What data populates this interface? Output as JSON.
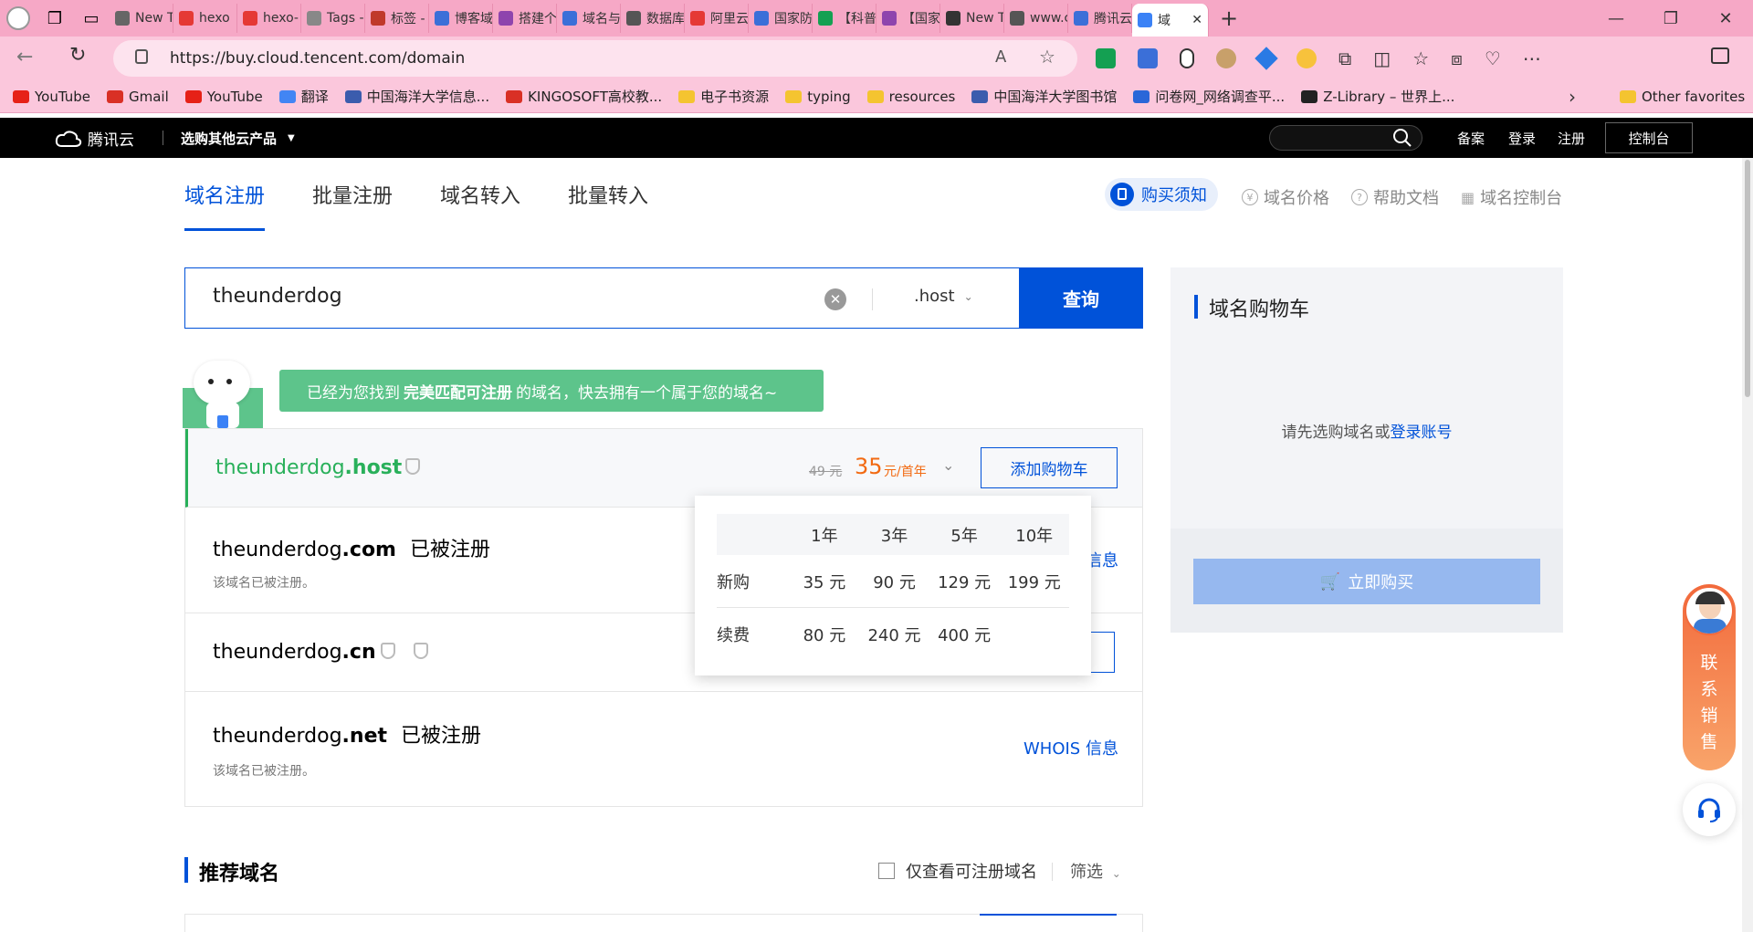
{
  "browser": {
    "tabs": [
      {
        "label": "New T"
      },
      {
        "label": "hexo"
      },
      {
        "label": "hexo-"
      },
      {
        "label": "Tags -"
      },
      {
        "label": "标签 -"
      },
      {
        "label": "博客域"
      },
      {
        "label": "搭建个"
      },
      {
        "label": "域名与"
      },
      {
        "label": "数据库"
      },
      {
        "label": "阿里云"
      },
      {
        "label": "国家防"
      },
      {
        "label": "【科普"
      },
      {
        "label": "【国家"
      },
      {
        "label": "New T"
      },
      {
        "label": "www.c"
      },
      {
        "label": "腾讯云"
      },
      {
        "label": "域"
      }
    ],
    "url": "https://buy.cloud.tencent.com/domain",
    "bookmarks": [
      {
        "label": "YouTube",
        "color": "#e62117"
      },
      {
        "label": "Gmail",
        "color": "#d93025"
      },
      {
        "label": "YouTube",
        "color": "#e62117"
      },
      {
        "label": "翻译",
        "color": "#4285f4"
      },
      {
        "label": "中国海洋大学信息...",
        "color": "#3b5cad"
      },
      {
        "label": "KINGOSOFT高校教...",
        "color": "#d93025"
      },
      {
        "label": "电子书资源",
        "color": "#f4c430"
      },
      {
        "label": "typing",
        "color": "#f4c430"
      },
      {
        "label": "resources",
        "color": "#f4c430"
      },
      {
        "label": "中国海洋大学图书馆",
        "color": "#3b5cad"
      },
      {
        "label": "问卷网_网络调查平...",
        "color": "#2a66d8"
      },
      {
        "label": "Z-Library – 世界上...",
        "color": "#222"
      }
    ],
    "other_favorites": "Other favorites"
  },
  "tc_header": {
    "logo": "腾讯云",
    "menu": "选购其他云产品",
    "links": [
      "备案",
      "登录",
      "注册"
    ],
    "console": "控制台"
  },
  "subnav": {
    "tabs": [
      "域名注册",
      "批量注册",
      "域名转入",
      "批量转入"
    ],
    "notice": "购买须知",
    "links": [
      "域名价格",
      "帮助文档",
      "域名控制台"
    ]
  },
  "search": {
    "query": "theunderdog",
    "suffix": ".host",
    "button": "查询"
  },
  "banner": {
    "prefix": "已经为您找到",
    "highlight": "完美匹配可注册",
    "suffix": "的域名，快去拥有一个属于您的域名~"
  },
  "results": [
    {
      "base": "theunderdog",
      "tld": ".host",
      "old_price": "49 元",
      "price": "35",
      "unit": "元/首年",
      "action": "添加购物车"
    },
    {
      "base": "theunderdog",
      "tld": ".com",
      "status": "已被注册",
      "note": "该域名已被注册。",
      "action": "WHOIS 信息"
    },
    {
      "base": "theunderdog",
      "tld": ".cn"
    },
    {
      "base": "theunderdog",
      "tld": ".net",
      "status": "已被注册",
      "note": "该域名已被注册。",
      "action": "WHOIS 信息"
    }
  ],
  "price_popover": {
    "headers": [
      "1年",
      "3年",
      "5年",
      "10年"
    ],
    "rows": [
      {
        "label": "新购",
        "values": [
          "35 元",
          "90 元",
          "129 元",
          "199 元"
        ]
      },
      {
        "label": "续费",
        "values": [
          "80 元",
          "240 元",
          "400 元",
          ""
        ]
      }
    ]
  },
  "cart": {
    "title": "域名购物车",
    "empty_text": "请先选购域名或",
    "login_link": "登录账号",
    "buy_button": "立即购买"
  },
  "recommend": {
    "title": "推荐域名",
    "checkbox_label": "仅查看可注册域名",
    "filter": "筛选"
  },
  "side": {
    "contact": "联系销售"
  },
  "colors": {
    "brand_blue": "#0052d9",
    "success_green": "#29b05a",
    "price_orange": "#f26a12"
  }
}
